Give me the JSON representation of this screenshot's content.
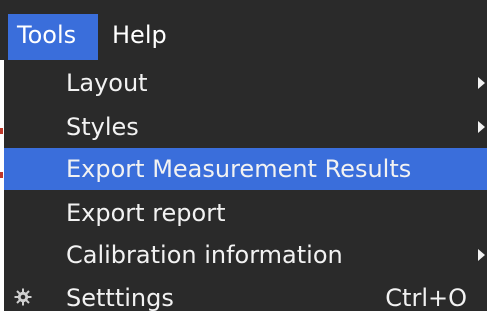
{
  "menubar": {
    "tools_label": "Tools",
    "help_label": "Help"
  },
  "menu": {
    "items": [
      {
        "label": "Layout",
        "has_submenu": true,
        "shortcut": ""
      },
      {
        "label": "Styles",
        "has_submenu": true,
        "shortcut": ""
      },
      {
        "label": "Export Measurement Results",
        "has_submenu": false,
        "shortcut": "",
        "highlighted": true
      },
      {
        "label": "Export report",
        "has_submenu": false,
        "shortcut": ""
      },
      {
        "label": "Calibration information",
        "has_submenu": true,
        "shortcut": ""
      },
      {
        "label": "Setttings",
        "has_submenu": false,
        "shortcut": "Ctrl+O",
        "icon": "gear-icon"
      }
    ]
  },
  "colors": {
    "menu_background": "#2a2a2a",
    "highlight": "#3a6edb",
    "text": "#f2f2f2"
  }
}
